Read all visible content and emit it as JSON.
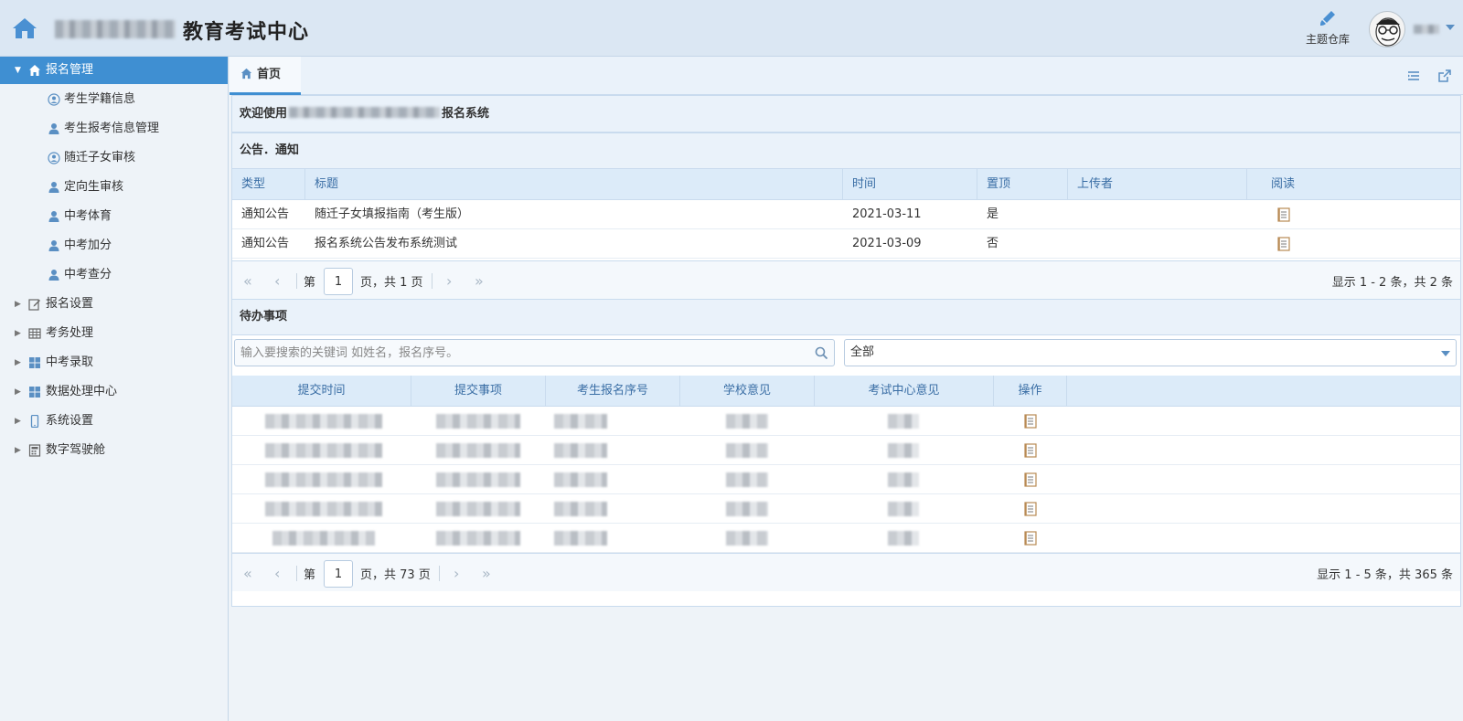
{
  "header": {
    "title": "教育考试中心",
    "theme_label": "主题仓库"
  },
  "sidebar": {
    "groups": [
      {
        "label": "报名管理",
        "icon": "home-icon",
        "expanded": true
      },
      {
        "label": "报名设置",
        "icon": "edit-icon"
      },
      {
        "label": "考务处理",
        "icon": "table-icon"
      },
      {
        "label": "中考录取",
        "icon": "grid-icon"
      },
      {
        "label": "数据处理中心",
        "icon": "grid-icon"
      },
      {
        "label": "系统设置",
        "icon": "mobile-icon"
      },
      {
        "label": "数字驾驶舱",
        "icon": "calculator-icon"
      }
    ],
    "sub_items": [
      {
        "label": "考生学籍信息",
        "icon": "user-circle-icon"
      },
      {
        "label": "考生报考信息管理",
        "icon": "user-icon"
      },
      {
        "label": "随迁子女审核",
        "icon": "user-circle-icon"
      },
      {
        "label": "定向生审核",
        "icon": "user-icon"
      },
      {
        "label": "中考体育",
        "icon": "user-icon"
      },
      {
        "label": "中考加分",
        "icon": "user-icon"
      },
      {
        "label": "中考查分",
        "icon": "user-icon"
      }
    ]
  },
  "tabs": [
    {
      "label": "首页",
      "icon": "home-icon"
    }
  ],
  "welcome": {
    "prefix": "欢迎使用",
    "suffix": "报名系统"
  },
  "notice": {
    "title": "公告．通知",
    "columns": [
      "类型",
      "标题",
      "时间",
      "置顶",
      "上传者",
      "阅读"
    ],
    "rows": [
      {
        "type": "通知公告",
        "title": "随迁子女填报指南（考生版）",
        "time": "2021-03-11",
        "top": "是"
      },
      {
        "type": "通知公告",
        "title": "报名系统公告发布系统测试",
        "time": "2021-03-09",
        "top": "否"
      }
    ],
    "pager": {
      "page_prefix": "第",
      "page": "1",
      "page_suffix": "页，共 1 页",
      "info": "显示 1 - 2 条，共 2 条"
    }
  },
  "todo": {
    "title": "待办事项",
    "search_placeholder": "输入要搜索的关键词 如姓名，报名序号。",
    "filter_value": "全部",
    "columns": [
      "提交时间",
      "提交事项",
      "考生报名序号",
      "学校意见",
      "考试中心意见",
      "操作"
    ],
    "row_count": 5,
    "pager": {
      "page_prefix": "第",
      "page": "1",
      "page_suffix": "页，共 73 页",
      "info": "显示 1 - 5 条，共 365 条"
    }
  },
  "colors": {
    "accent": "#3f8fd2",
    "header_bg": "#dbe7f3",
    "table_head": "#dcebf9"
  }
}
